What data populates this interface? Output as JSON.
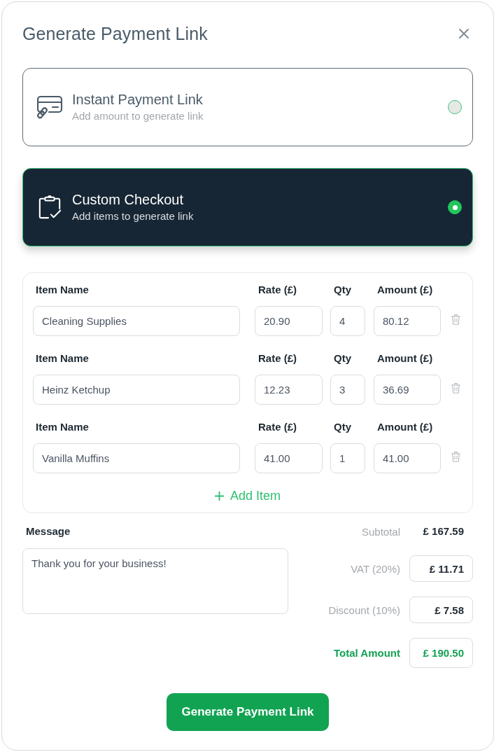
{
  "dialog": {
    "title": "Generate Payment Link"
  },
  "options": [
    {
      "kind": "instant",
      "title": "Instant Payment Link",
      "subtitle": "Add amount to generate link",
      "selected": false
    },
    {
      "kind": "checkout",
      "title": "Custom Checkout",
      "subtitle": "Add items to generate link",
      "selected": true
    }
  ],
  "items": [
    {
      "headers": [
        "Item Name",
        "Rate (£)",
        "Qty",
        "Amount (£)"
      ],
      "name": "Cleaning Supplies",
      "rate": "20.90",
      "qty": "4",
      "amount": "80.12"
    },
    {
      "headers": [
        "Item Name",
        "Rate (£)",
        "Qty",
        "Amount (£)"
      ],
      "name": "Heinz Ketchup",
      "rate": "12.23",
      "qty": "3",
      "amount": "36.69"
    },
    {
      "headers": [
        "Item Name",
        "Rate (£)",
        "Qty",
        "Amount (£)"
      ],
      "name": "Vanilla Muffins",
      "rate": "41.00",
      "qty": "1",
      "amount": "41.00"
    }
  ],
  "add_item": "Add Item",
  "message": {
    "label": "Message",
    "value": "Thank you for your business!"
  },
  "summary": [
    {
      "kind": "plain",
      "label": "Subtotal",
      "value": "£ 167.59"
    },
    {
      "kind": "boxed",
      "label": "VAT (20%)",
      "value": "£ 11.71"
    },
    {
      "kind": "boxed",
      "label": "Discount (10%)",
      "value": "£ 7.58"
    },
    {
      "kind": "total",
      "label": "Total Amount",
      "value": "£ 190.50"
    }
  ],
  "submit": "Generate Payment Link"
}
